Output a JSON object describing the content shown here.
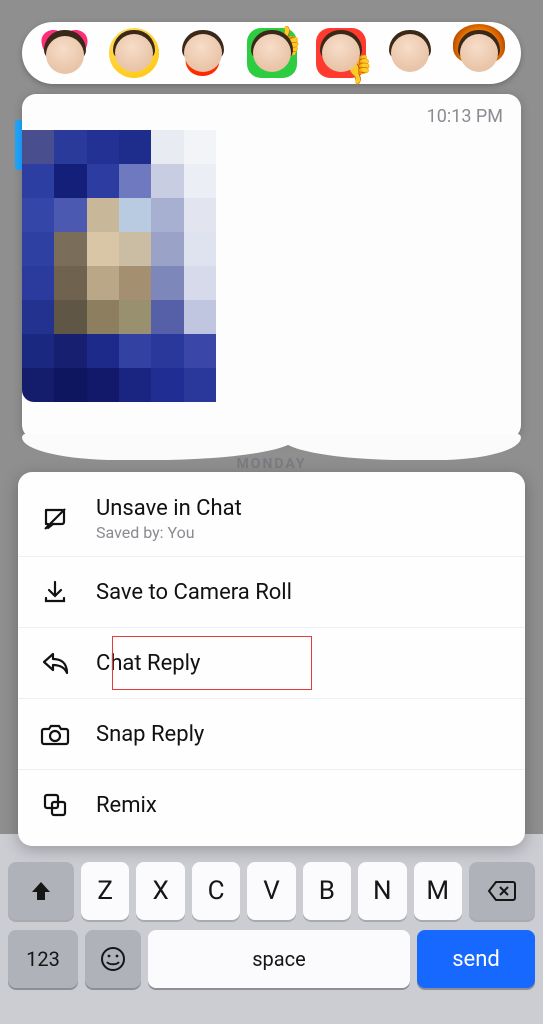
{
  "reactions": [
    {
      "name": "love-heart"
    },
    {
      "name": "laughing"
    },
    {
      "name": "fire"
    },
    {
      "name": "thumbs-up"
    },
    {
      "name": "thumbs-down"
    },
    {
      "name": "neutral"
    },
    {
      "name": "mind-blown"
    }
  ],
  "message": {
    "timestamp": "10:13 PM",
    "day_label": "MONDAY",
    "pixel_colors": [
      "#494e8e",
      "#2a3a9b",
      "#223193",
      "#1e2c8c",
      "#e9ebf3",
      "#f3f4f8",
      "#2d3ea3",
      "#141f7a",
      "#2c3ca0",
      "#6e79bf",
      "#c9cde2",
      "#eceef5",
      "#3446a8",
      "#4b59b0",
      "#c9b79a",
      "#b8cbe0",
      "#a7b0d0",
      "#e2e5f0",
      "#2f40a3",
      "#7a6e5a",
      "#d9c6a6",
      "#cabda3",
      "#9aa2c8",
      "#dfe2ef",
      "#2b3b9d",
      "#6f6350",
      "#b9a787",
      "#a49070",
      "#7d87b9",
      "#d6daeb",
      "#23318f",
      "#5f5646",
      "#8e7e60",
      "#99906f",
      "#5560a8",
      "#c0c6e0",
      "#1b2880",
      "#161f70",
      "#1d2a89",
      "#3341a2",
      "#2a379b",
      "#3a47a8",
      "#141c6c",
      "#0f1660",
      "#12196a",
      "#1a2582",
      "#202d92",
      "#2a379b"
    ]
  },
  "menu": {
    "unsave": {
      "label": "Unsave in Chat",
      "sub": "Saved by: You"
    },
    "camera_roll": {
      "label": "Save to Camera Roll"
    },
    "chat_reply": {
      "label": "Chat Reply"
    },
    "snap_reply": {
      "label": "Snap Reply"
    },
    "remix": {
      "label": "Remix"
    }
  },
  "keyboard": {
    "keys": [
      "Z",
      "X",
      "C",
      "V",
      "B",
      "N",
      "M"
    ],
    "numeric": "123",
    "space": "space",
    "send": "send"
  }
}
